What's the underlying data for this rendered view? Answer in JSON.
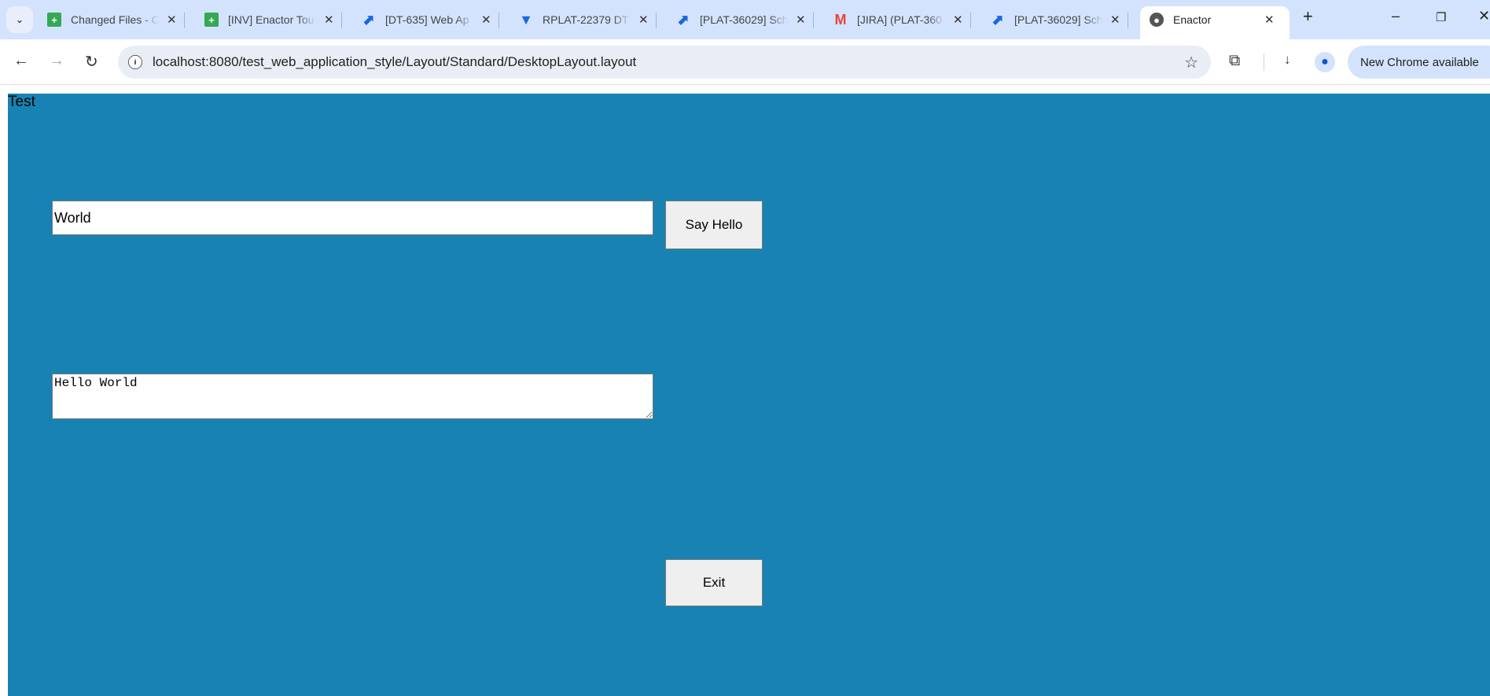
{
  "browser": {
    "tabs": [
      {
        "title": "Changed Files - C",
        "icon": "sheets-icon",
        "color": "#34a853"
      },
      {
        "title": "[INV] Enactor Tou",
        "icon": "sheets-icon",
        "color": "#34a853"
      },
      {
        "title": "[DT-635] Web Ap",
        "icon": "jira-icon",
        "color": "#1868db"
      },
      {
        "title": "RPLAT-22379 DT",
        "icon": "shield-icon",
        "color": "#1868db"
      },
      {
        "title": "[PLAT-36029] Sch",
        "icon": "jira-icon",
        "color": "#1868db"
      },
      {
        "title": "[JIRA] (PLAT-360",
        "icon": "gmail-icon",
        "color": "#ea4335"
      },
      {
        "title": "[PLAT-36029] Sch",
        "icon": "jira-icon",
        "color": "#1868db"
      }
    ],
    "active_tab": {
      "title": "Enactor",
      "icon": "globe-icon"
    },
    "url": "localhost:8080/test_web_application_style/Layout/Standard/DesktopLayout.layout",
    "update_label": "New Chrome available"
  },
  "page": {
    "heading": "Test",
    "name_value": "World",
    "say_hello_label": "Say Hello",
    "output_value": "Hello World",
    "exit_label": "Exit",
    "background_color": "#1883b3"
  }
}
